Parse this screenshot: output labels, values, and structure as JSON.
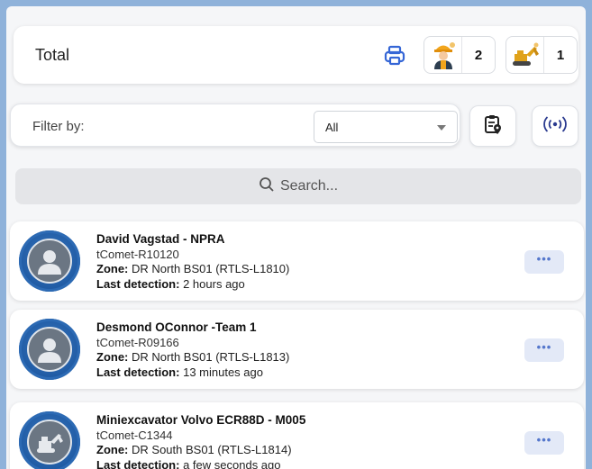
{
  "header": {
    "total_label": "Total",
    "counters": [
      {
        "icon": "worker-icon",
        "count": "2"
      },
      {
        "icon": "excavator-icon",
        "count": "1"
      }
    ]
  },
  "filter": {
    "label": "Filter by:",
    "selected": "All"
  },
  "search": {
    "placeholder": "Search..."
  },
  "zone_label": "Zone:",
  "last_detection_label": "Last detection:",
  "items": [
    {
      "name": "David Vagstad - NPRA",
      "device": "tComet-R10120",
      "zone": "DR North BS01 (RTLS-L1810)",
      "last_detection": "2 hours ago",
      "more": "•••"
    },
    {
      "name": "Desmond OConnor -Team 1",
      "device": "tComet-R09166",
      "zone": "DR North BS01 (RTLS-L1813)",
      "last_detection": "13 minutes ago",
      "more": "•••"
    },
    {
      "name": "Miniexcavator Volvo ECR88D - M005",
      "device": "tComet-C1344",
      "zone": "DR South BS01 (RTLS-L1814)",
      "last_detection": "a few seconds ago",
      "more": "•••"
    }
  ],
  "colors": {
    "background": "#8fb2da",
    "avatar_blue": "#1f5aa3",
    "more_button": "#e3e9f7"
  }
}
